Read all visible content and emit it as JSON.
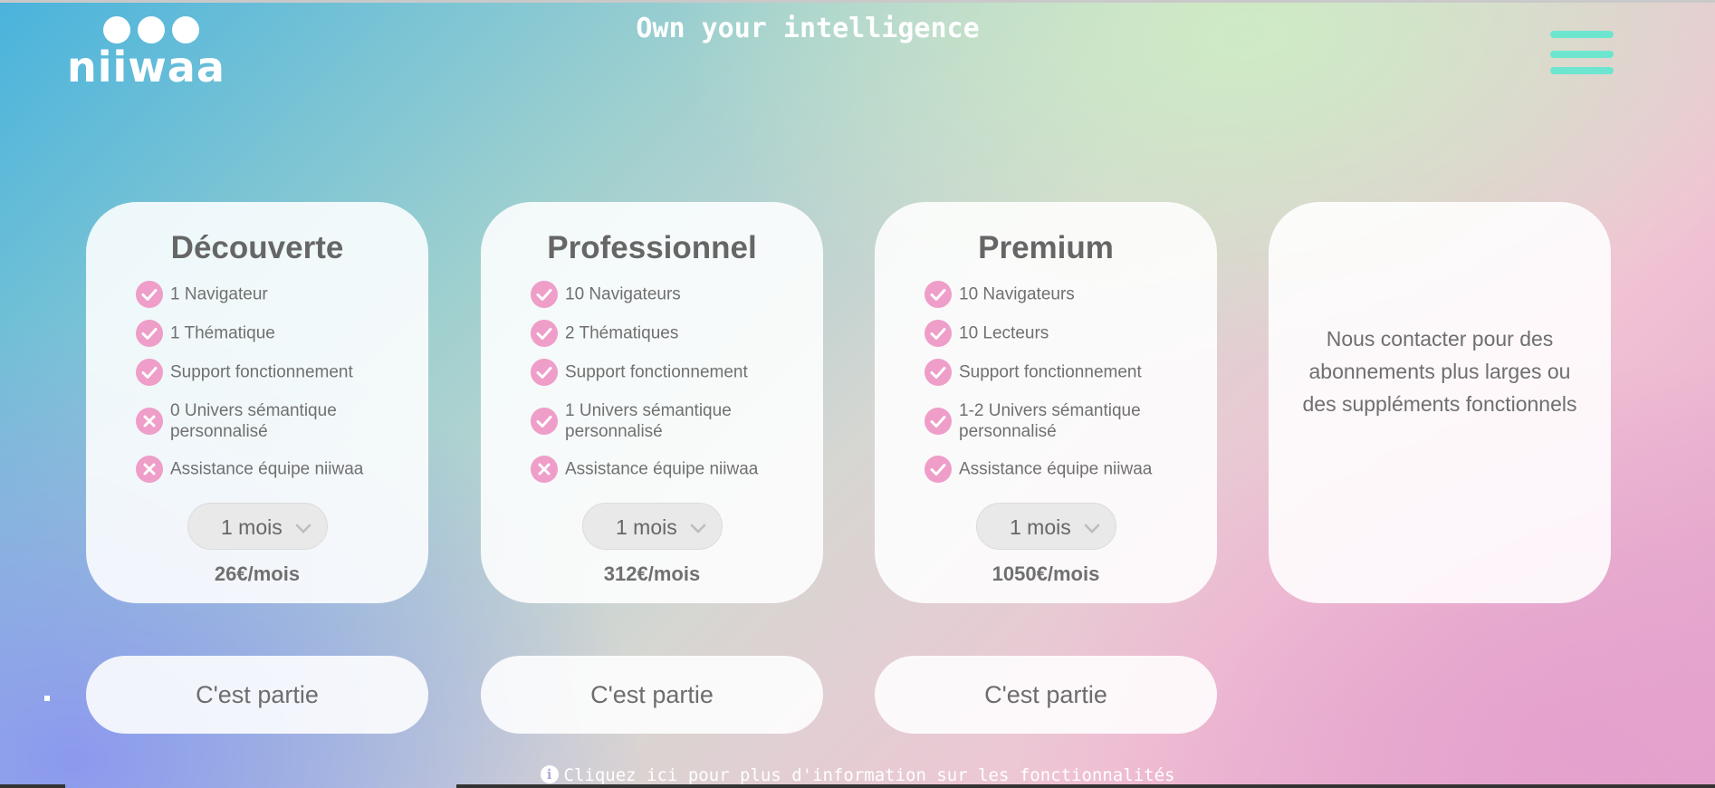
{
  "header": {
    "logo_text": "niiwaa",
    "tagline": "Own your intelligence",
    "menu_icon": "hamburger-menu-icon"
  },
  "colors": {
    "accent_check": "#ee9ec8",
    "menu": "#6ee6cf",
    "card_text": "#6f6f6f"
  },
  "plans": [
    {
      "title": "Découverte",
      "features": [
        {
          "text": "1 Navigateur",
          "included": true
        },
        {
          "text": "1 Thématique",
          "included": true
        },
        {
          "text": "Support fonctionnement",
          "included": true
        },
        {
          "text": "0 Univers sémantique personnalisé",
          "included": false
        },
        {
          "text": "Assistance équipe niiwaa",
          "included": false
        }
      ],
      "duration": "1 mois",
      "price": "26€/mois",
      "cta": "C'est partie"
    },
    {
      "title": "Professionnel",
      "features": [
        {
          "text": "10 Navigateurs",
          "included": true
        },
        {
          "text": "2 Thématiques",
          "included": true
        },
        {
          "text": "Support fonctionnement",
          "included": true
        },
        {
          "text": "1 Univers sémantique personnalisé",
          "included": true
        },
        {
          "text": "Assistance équipe niiwaa",
          "included": false
        }
      ],
      "duration": "1 mois",
      "price": "312€/mois",
      "cta": "C'est partie"
    },
    {
      "title": "Premium",
      "features": [
        {
          "text": "10 Navigateurs",
          "included": true
        },
        {
          "text": "10 Lecteurs",
          "included": true
        },
        {
          "text": "Support fonctionnement",
          "included": true
        },
        {
          "text": "1-2 Univers sémantique personnalisé",
          "included": true
        },
        {
          "text": "Assistance équipe niiwaa",
          "included": true
        }
      ],
      "duration": "1 mois",
      "price": "1050€/mois",
      "cta": "C'est partie"
    }
  ],
  "contact_card": {
    "text": "Nous contacter pour des abonnements plus larges ou des suppléments fonctionnels"
  },
  "footer": {
    "info_icon": "info-circle-icon",
    "info_text": "Cliquez ici pour plus d'information sur les fonctionnalités"
  }
}
